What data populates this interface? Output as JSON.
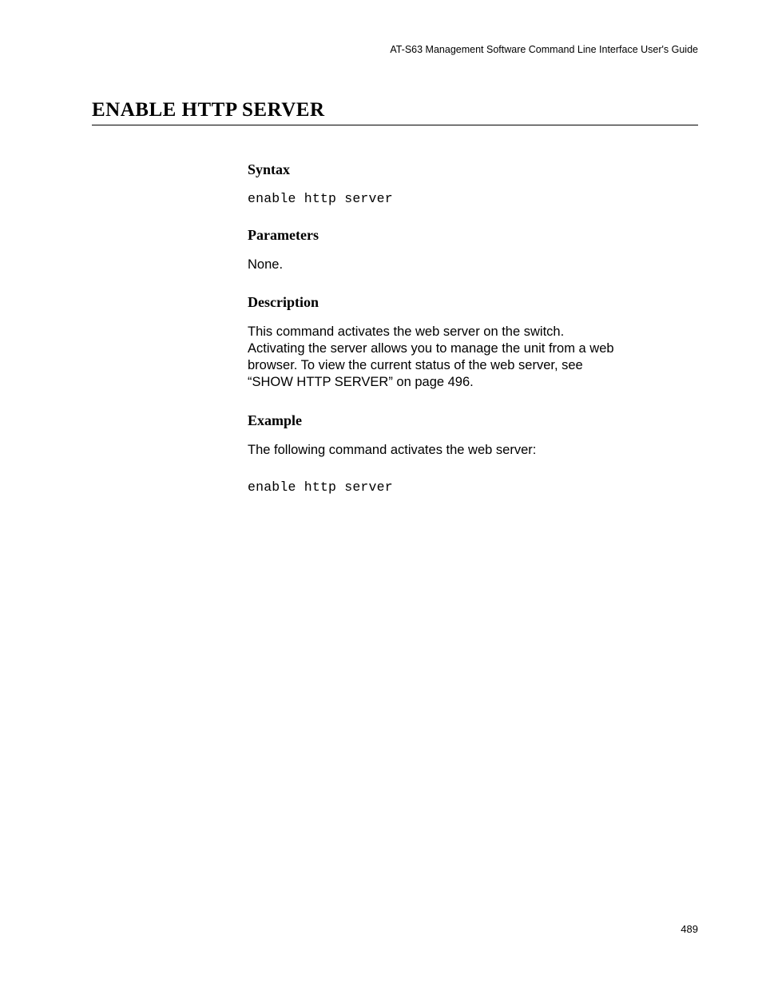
{
  "header": {
    "running": "AT-S63 Management Software Command Line Interface User's Guide"
  },
  "title": "ENABLE HTTP SERVER",
  "sections": {
    "syntax": {
      "heading": "Syntax",
      "code": "enable http server"
    },
    "parameters": {
      "heading": "Parameters",
      "text": "None."
    },
    "description": {
      "heading": "Description",
      "text": "This command activates the web server on the switch. Activating the server allows you to manage the unit from a web browser. To view the current status of the web server, see “SHOW HTTP SERVER” on page 496."
    },
    "example": {
      "heading": "Example",
      "text": "The following command activates the web server:",
      "code": "enable http server"
    }
  },
  "pageNumber": "489"
}
